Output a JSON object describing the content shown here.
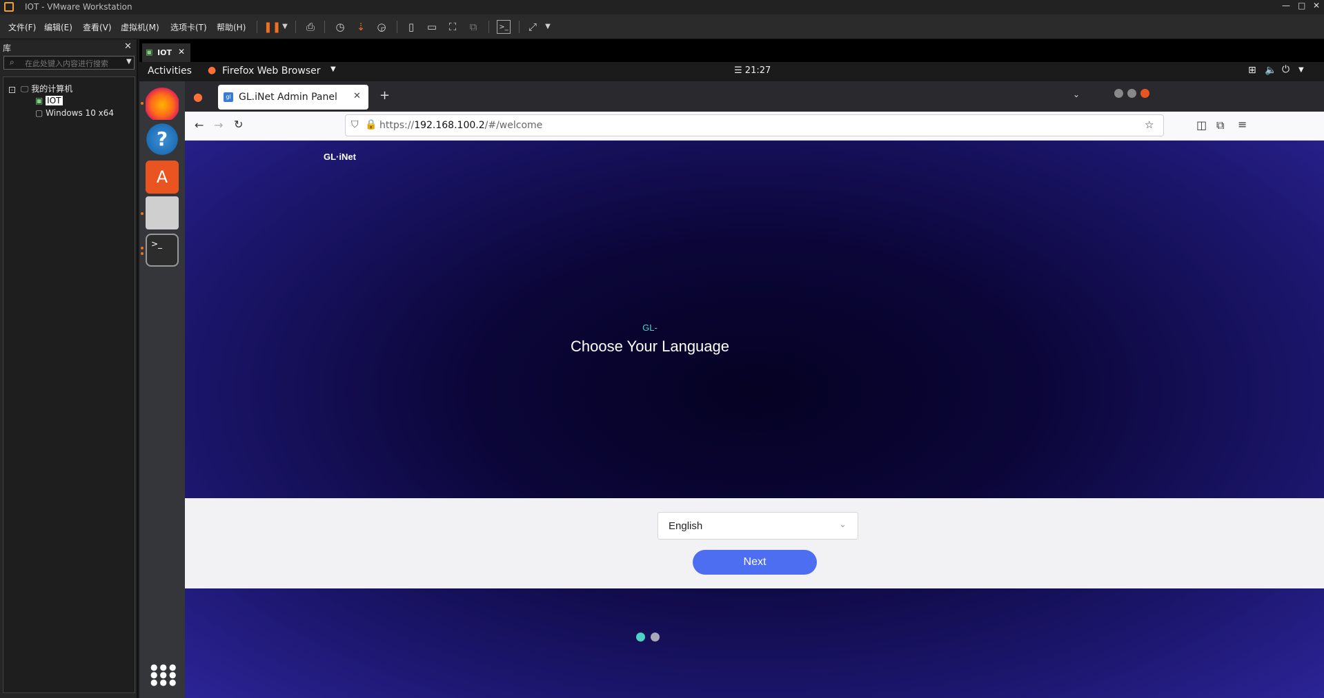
{
  "window": {
    "title": "IOT - VMware Workstation"
  },
  "menu": [
    "文件(F)",
    "编辑(E)",
    "查看(V)",
    "虚拟机(M)",
    "选项卡(T)",
    "帮助(H)"
  ],
  "library": {
    "header": "库",
    "search_placeholder": "在此处键入内容进行搜索",
    "root": "我的计算机",
    "items": [
      "IOT",
      "Windows 10 x64"
    ]
  },
  "vm_tab": {
    "label": "IOT"
  },
  "gnome": {
    "activities": "Activities",
    "app": "Firefox Web Browser",
    "clock": "21:27"
  },
  "browser": {
    "tab_title": "GL.iNet Admin Panel",
    "url_scheme": "https://",
    "url_host": "192.168.100.2",
    "url_path": "/#/welcome"
  },
  "page": {
    "logo": "GL·iNet",
    "subtitle": "GL-",
    "heading": "Choose Your Language",
    "language_selected": "English",
    "next_label": "Next"
  },
  "colors": {
    "accent": "#4d6ef0",
    "dot_active": "#4fd1c5",
    "dot_inactive": "#a8a8b8"
  }
}
